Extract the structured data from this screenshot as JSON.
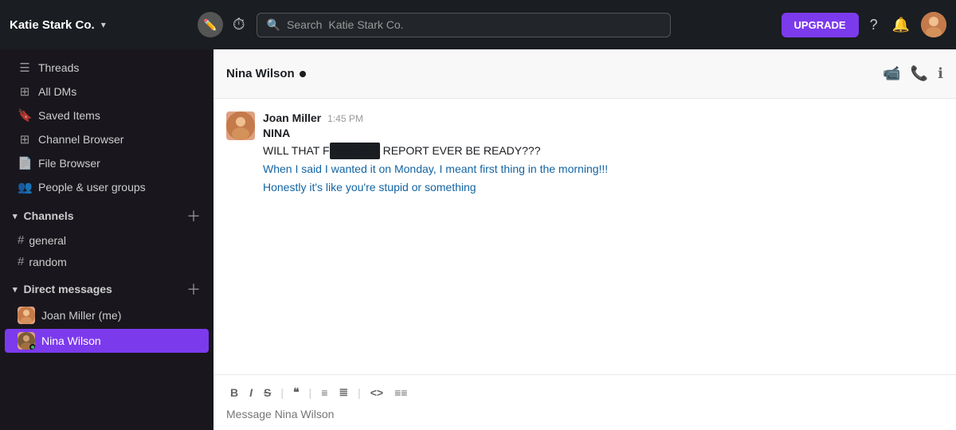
{
  "workspace": {
    "name": "Katie Stark Co.",
    "chevron": "▾"
  },
  "topnav": {
    "search_placeholder": "Search",
    "search_workspace": "Katie Stark Co.",
    "upgrade_label": "UPGRADE"
  },
  "sidebar": {
    "nav_items": [
      {
        "id": "threads",
        "label": "Threads",
        "icon": "≡"
      },
      {
        "id": "all-dms",
        "label": "All DMs",
        "icon": "⊞"
      },
      {
        "id": "saved-items",
        "label": "Saved Items",
        "icon": "🔖"
      },
      {
        "id": "channel-browser",
        "label": "Channel Browser",
        "icon": "⊞"
      },
      {
        "id": "file-browser",
        "label": "File Browser",
        "icon": "📄"
      },
      {
        "id": "people-user-groups",
        "label": "People & user groups",
        "icon": "👥"
      }
    ],
    "channels_section": "Channels",
    "channels": [
      {
        "id": "general",
        "label": "general"
      },
      {
        "id": "random",
        "label": "random"
      }
    ],
    "dms_section": "Direct messages",
    "dms": [
      {
        "id": "joan-miller",
        "label": "Joan Miller (me)",
        "active": false
      },
      {
        "id": "nina-wilson",
        "label": "Nina Wilson",
        "active": true
      }
    ]
  },
  "chat": {
    "recipient_name": "Nina Wilson",
    "messages": [
      {
        "author": "Joan Miller",
        "time": "1:45 PM",
        "recipient": "NINA",
        "lines": [
          {
            "text": "WILL THAT F",
            "censored": "■■■■■■■■",
            "after": " REPORT EVER BE READY???"
          },
          {
            "text": "When I said I wanted it on Monday, I meant first thing in the morning!!!",
            "highlight": true
          },
          {
            "text": "Honestly it's like you're stupid or something",
            "highlight": true
          }
        ]
      }
    ],
    "input_placeholder": "Message Nina Wilson",
    "toolbar_buttons": [
      "B",
      "I",
      "S",
      "❝",
      "|",
      "≡",
      "≣",
      "|",
      "<>",
      "≡≡"
    ]
  }
}
